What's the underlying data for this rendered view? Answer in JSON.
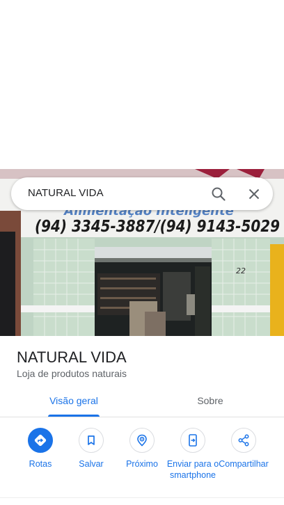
{
  "search": {
    "query": "NATURAL VIDA"
  },
  "photo": {
    "sign_upper": "Alimentação Inteligente",
    "sign_phone": "(94) 3345-3887/(94) 9143-5029",
    "street_number": "22"
  },
  "place": {
    "name": "NATURAL VIDA",
    "category": "Loja de produtos naturais"
  },
  "tabs": [
    {
      "label": "Visão geral",
      "selected": true
    },
    {
      "label": "Sobre",
      "selected": false
    }
  ],
  "actions": [
    {
      "label": "Rotas",
      "icon": "directions-icon"
    },
    {
      "label": "Salvar",
      "icon": "bookmark-icon"
    },
    {
      "label": "Próximo",
      "icon": "nearby-icon"
    },
    {
      "label": "Enviar para o smartphone",
      "icon": "send-to-phone-icon"
    },
    {
      "label": "Compartilhar",
      "icon": "share-icon"
    }
  ],
  "colors": {
    "accent": "#1a73e8",
    "text": "#202124",
    "secondary": "#5f6368"
  }
}
